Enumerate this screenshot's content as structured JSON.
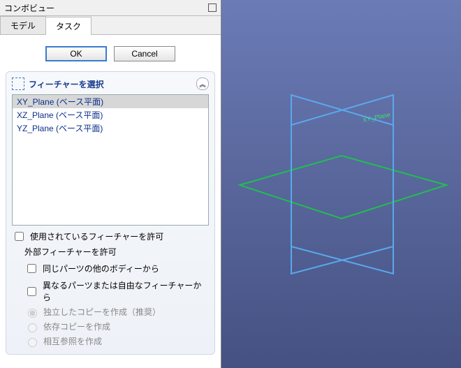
{
  "titlebar": {
    "title": "コンボビュー"
  },
  "tabs": {
    "model": "モデル",
    "task": "タスク"
  },
  "buttons": {
    "ok": "OK",
    "cancel": "Cancel"
  },
  "group": {
    "title": "フィーチャーを選択",
    "items": [
      "XY_Plane (ベース平面)",
      "XZ_Plane (ベース平面)",
      "YZ_Plane (ベース平面)"
    ]
  },
  "checks": {
    "allow_used": "使用されているフィーチャーを許可",
    "external_header": "外部フィーチャーを許可",
    "other_body": "同じパーツの他のボディーから",
    "other_part": "異なるパーツまたは自由なフィーチャーから"
  },
  "radios": {
    "independent": "独立したコピーを作成（推奨）",
    "dependent": "依存コピーを作成",
    "crossref": "相互参照を作成"
  },
  "viewport": {
    "selected_label": "XY_Plane"
  }
}
